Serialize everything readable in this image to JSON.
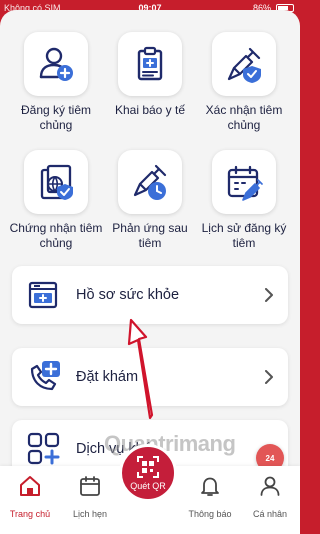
{
  "statusbar": {
    "carrier": "Không có SIM",
    "time": "09:07",
    "battery": "86%"
  },
  "grid": {
    "items": [
      {
        "label": "Đăng ký tiêm chủng",
        "icon": "register-user-icon"
      },
      {
        "label": "Khai báo y tế",
        "icon": "medical-clipboard-icon"
      },
      {
        "label": "Xác nhận tiêm chủng",
        "icon": "syringe-shield-icon"
      },
      {
        "label": "Chứng nhận tiêm chủng",
        "icon": "certificate-globe-icon"
      },
      {
        "label": "Phản ứng sau tiêm",
        "icon": "syringe-clock-icon"
      },
      {
        "label": "Lịch sử đăng ký tiêm",
        "icon": "calendar-syringe-icon"
      }
    ]
  },
  "list": {
    "items": [
      {
        "label": "Hồ sơ sức khỏe",
        "icon": "health-record-icon"
      },
      {
        "label": "Đặt khám",
        "icon": "phone-medical-icon"
      },
      {
        "label": "Dịch vụ khác",
        "icon": "grid-plus-icon"
      }
    ]
  },
  "watermark": "Quantrimang",
  "chat_badge": "24",
  "nav": {
    "items": [
      {
        "label": "Trang chủ",
        "icon": "home-icon",
        "active": true
      },
      {
        "label": "Lịch hẹn",
        "icon": "calendar-icon",
        "active": false
      },
      {
        "label": "Quét QR",
        "icon": "qr-scan-icon",
        "active": false
      },
      {
        "label": "Thông báo",
        "icon": "bell-icon",
        "active": false
      },
      {
        "label": "Cá nhân",
        "icon": "user-icon",
        "active": false
      }
    ]
  },
  "colors": {
    "brand_red": "#c61e2c",
    "icon_navy": "#1f2a6b",
    "icon_accent": "#3b6fd8",
    "background": "#f4f4f4"
  }
}
